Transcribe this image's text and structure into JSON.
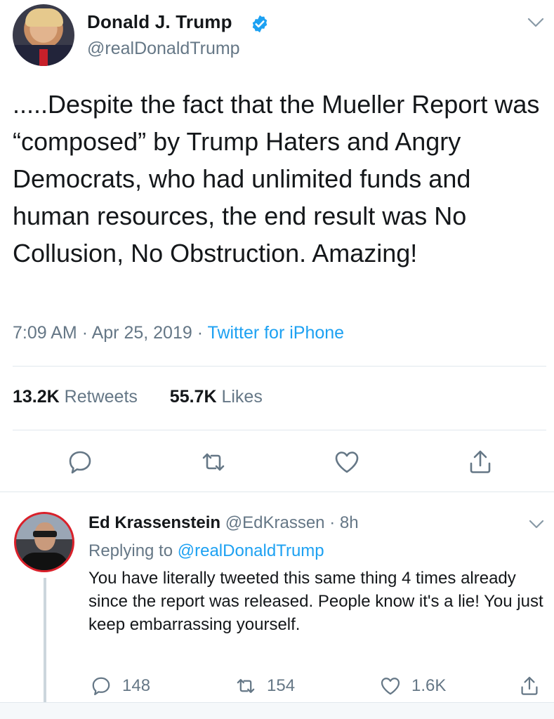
{
  "main_tweet": {
    "author_name": "Donald J. Trump",
    "author_handle": "@realDonaldTrump",
    "text": ".....Despite the fact that the Mueller Report was “composed” by Trump Haters and Angry Democrats, who had unlimited funds and human resources, the end result was No Collusion, No Obstruction. Amazing!",
    "time": "7:09 AM",
    "date": "Apr 25, 2019",
    "source": "Twitter for iPhone",
    "retweets_count": "13.2K",
    "retweets_label": "Retweets",
    "likes_count": "55.7K",
    "likes_label": "Likes"
  },
  "reply": {
    "author_name": "Ed Krassenstein",
    "author_handle": "@EdKrassen",
    "age": "8h",
    "replying_prefix": "Replying to",
    "replying_to": "@realDonaldTrump",
    "text": "You have literally tweeted this same thing 4 times already since the report was released.  People know it's a lie!  You just keep embarrassing yourself.",
    "replies_count": "148",
    "retweets_count": "154",
    "likes_count": "1.6K"
  },
  "colors": {
    "accent": "#1da1f2",
    "muted": "#657786",
    "text": "#14171a",
    "divider": "#e1e8ed"
  },
  "icons": [
    "verified-badge-icon",
    "chevron-down-icon",
    "reply-icon",
    "retweet-icon",
    "like-icon",
    "share-icon"
  ]
}
